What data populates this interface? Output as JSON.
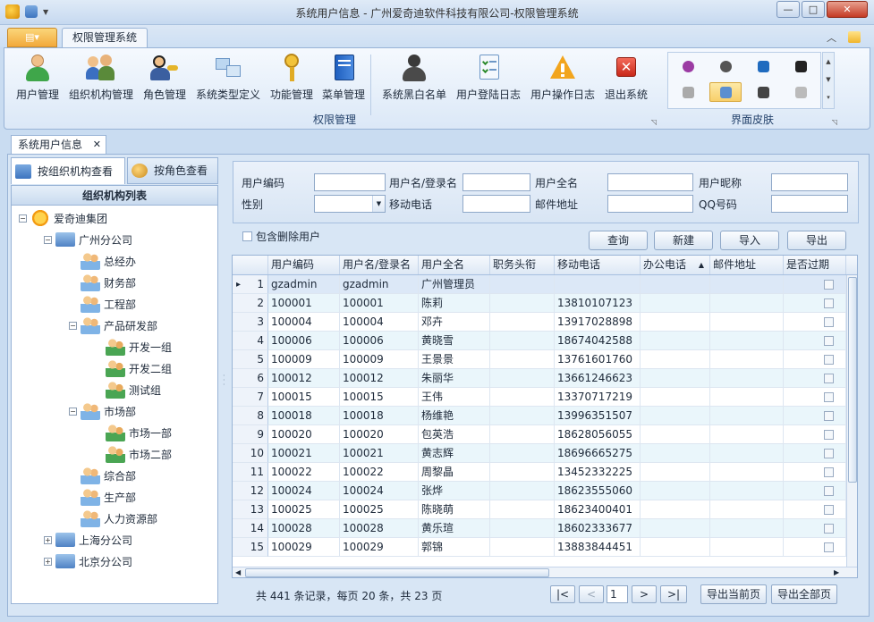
{
  "window": {
    "title": "系统用户信息 - 广州爱奇迪软件科技有限公司-权限管理系统",
    "min": "—",
    "max": "□",
    "close": "✕"
  },
  "ribbon": {
    "tab": "权限管理系统",
    "groups": [
      {
        "label": "权限管理"
      },
      {
        "label": "界面皮肤"
      }
    ],
    "buttons": [
      {
        "label": "用户管理",
        "icon": "user-icon"
      },
      {
        "label": "组织机构管理",
        "icon": "org-users-icon"
      },
      {
        "label": "角色管理",
        "icon": "role-key-icon"
      },
      {
        "label": "系统类型定义",
        "icon": "system-type-icon"
      },
      {
        "label": "功能管理",
        "icon": "key-icon"
      },
      {
        "label": "菜单管理",
        "icon": "menu-book-icon"
      },
      {
        "label": "系统黑白名单",
        "icon": "blacklist-user-icon"
      },
      {
        "label": "用户登陆日志",
        "icon": "login-log-icon"
      },
      {
        "label": "用户操作日志",
        "icon": "warning-icon"
      },
      {
        "label": "退出系统",
        "icon": "exit-icon"
      }
    ]
  },
  "doc_tab": {
    "label": "系统用户信息",
    "close": "✕"
  },
  "left_tabs": [
    {
      "label": "按组织机构查看"
    },
    {
      "label": "按角色查看"
    }
  ],
  "tree": {
    "title": "组织机构列表",
    "nodes": [
      {
        "label": "爱奇迪集团",
        "level": 0,
        "expander": "−",
        "icon": "sun-icon"
      },
      {
        "label": "广州分公司",
        "level": 1,
        "expander": "−",
        "icon": "company-icon"
      },
      {
        "label": "总经办",
        "level": 2,
        "expander": "",
        "icon": "users-group-icon"
      },
      {
        "label": "财务部",
        "level": 2,
        "expander": "",
        "icon": "users-group-icon"
      },
      {
        "label": "工程部",
        "level": 2,
        "expander": "",
        "icon": "users-group-icon"
      },
      {
        "label": "产品研发部",
        "level": 2,
        "expander": "−",
        "icon": "users-group-icon"
      },
      {
        "label": "开发一组",
        "level": 3,
        "expander": "",
        "icon": "team-icon"
      },
      {
        "label": "开发二组",
        "level": 3,
        "expander": "",
        "icon": "team-icon"
      },
      {
        "label": "测试组",
        "level": 3,
        "expander": "",
        "icon": "team-icon"
      },
      {
        "label": "市场部",
        "level": 2,
        "expander": "−",
        "icon": "users-group-icon"
      },
      {
        "label": "市场一部",
        "level": 3,
        "expander": "",
        "icon": "team-icon"
      },
      {
        "label": "市场二部",
        "level": 3,
        "expander": "",
        "icon": "team-icon"
      },
      {
        "label": "综合部",
        "level": 2,
        "expander": "",
        "icon": "users-group-icon"
      },
      {
        "label": "生产部",
        "level": 2,
        "expander": "",
        "icon": "users-group-icon"
      },
      {
        "label": "人力资源部",
        "level": 2,
        "expander": "",
        "icon": "users-group-icon"
      },
      {
        "label": "上海分公司",
        "level": 1,
        "expander": "+",
        "icon": "company-icon"
      },
      {
        "label": "北京分公司",
        "level": 1,
        "expander": "+",
        "icon": "company-icon"
      }
    ]
  },
  "filters": {
    "labels": {
      "user_code": "用户编码",
      "login_name": "用户名/登录名",
      "full_name": "用户全名",
      "nickname": "用户昵称",
      "gender": "性别",
      "mobile": "移动电话",
      "email": "邮件地址",
      "qq": "QQ号码"
    },
    "include_deleted": "包含删除用户",
    "buttons": {
      "query": "查询",
      "new": "新建",
      "import": "导入",
      "export": "导出"
    }
  },
  "grid": {
    "columns": [
      "用户编码",
      "用户名/登录名",
      "用户全名",
      "职务头衔",
      "移动电话",
      "办公电话",
      "邮件地址",
      "是否过期"
    ],
    "sort_indicator": "▲",
    "current_row_marker": "▸",
    "rows": [
      {
        "n": "1",
        "code": "gzadmin",
        "login": "gzadmin",
        "name": "广州管理员",
        "mobile": ""
      },
      {
        "n": "2",
        "code": "100001",
        "login": "100001",
        "name": "陈莉",
        "mobile": "13810107123"
      },
      {
        "n": "3",
        "code": "100004",
        "login": "100004",
        "name": "邓卉",
        "mobile": "13917028898"
      },
      {
        "n": "4",
        "code": "100006",
        "login": "100006",
        "name": "黄晓雪",
        "mobile": "18674042588"
      },
      {
        "n": "5",
        "code": "100009",
        "login": "100009",
        "name": "王景景",
        "mobile": "13761601760"
      },
      {
        "n": "6",
        "code": "100012",
        "login": "100012",
        "name": "朱丽华",
        "mobile": "13661246623"
      },
      {
        "n": "7",
        "code": "100015",
        "login": "100015",
        "name": "王伟",
        "mobile": "13370717219"
      },
      {
        "n": "8",
        "code": "100018",
        "login": "100018",
        "name": "杨维艳",
        "mobile": "13996351507"
      },
      {
        "n": "9",
        "code": "100020",
        "login": "100020",
        "name": "包英浩",
        "mobile": "18628056055"
      },
      {
        "n": "10",
        "code": "100021",
        "login": "100021",
        "name": "黄志辉",
        "mobile": "18696665275"
      },
      {
        "n": "11",
        "code": "100022",
        "login": "100022",
        "name": "周黎晶",
        "mobile": "13452332225"
      },
      {
        "n": "12",
        "code": "100024",
        "login": "100024",
        "name": "张烨",
        "mobile": "18623555060"
      },
      {
        "n": "13",
        "code": "100025",
        "login": "100025",
        "name": "陈晓萌",
        "mobile": "18623400401"
      },
      {
        "n": "14",
        "code": "100028",
        "login": "100028",
        "name": "黄乐瑄",
        "mobile": "18602333677"
      },
      {
        "n": "15",
        "code": "100029",
        "login": "100029",
        "name": "郭锦",
        "mobile": "13883844451"
      }
    ]
  },
  "pager": {
    "summary": "共 441 条记录，每页 20 条，共 23 页",
    "first": "|<",
    "prev": "<",
    "page": "1",
    "next": ">",
    "last": ">|",
    "export_current": "导出当前页",
    "export_all": "导出全部页"
  },
  "colors": {
    "accent": "#f2a93b",
    "row_alt": "#eaf6fb",
    "row_selected": "#dce8f7",
    "border": "#98b3d6"
  }
}
